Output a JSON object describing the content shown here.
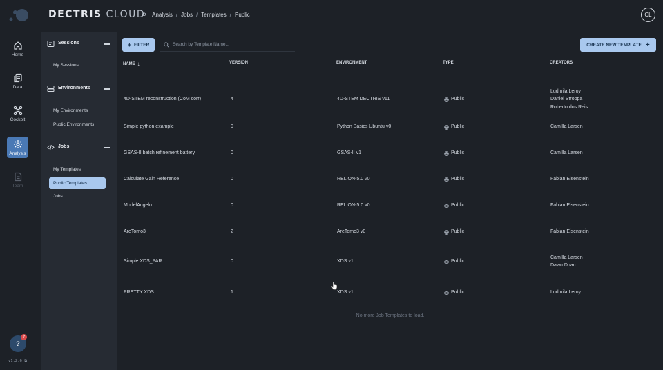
{
  "app": {
    "brand_primary": "DECTRIS",
    "brand_secondary": "CLOUD",
    "avatar_initials": "CL",
    "version": "v1.2.6"
  },
  "breadcrumb": [
    "Analysis",
    "Jobs",
    "Templates",
    "Public"
  ],
  "rail": [
    {
      "label": "Home",
      "icon": "home-icon"
    },
    {
      "label": "Data",
      "icon": "documents-icon"
    },
    {
      "label": "Cockpit",
      "icon": "network-icon"
    },
    {
      "label": "Analysis",
      "icon": "gear-icon",
      "active": true
    },
    {
      "label": "Team",
      "icon": "document-icon",
      "disabled": true
    }
  ],
  "help": {
    "label": "?",
    "badge": "7"
  },
  "sidenav": {
    "sessions": {
      "title": "Sessions",
      "items": [
        "My Sessions"
      ]
    },
    "environments": {
      "title": "Environments",
      "items": [
        "My Environments",
        "Public Environments"
      ]
    },
    "jobs": {
      "title": "Jobs",
      "items": [
        "My Templates",
        "Public Templates",
        "Jobs"
      ],
      "active_index": 1
    }
  },
  "toolbar": {
    "filter_label": "FILTER",
    "search_placeholder": "Search by Template Name...",
    "create_label": "CREATE NEW TEMPLATE"
  },
  "table": {
    "columns": [
      "NAME",
      "VERSION",
      "ENVIRONMENT",
      "TYPE",
      "CREATORS"
    ],
    "rows": [
      {
        "name": "4D-STEM reconstruction (CoM corr)",
        "version": "4",
        "environment": "4D-STEM DECTRIS v11",
        "type": "Public",
        "creators": [
          "Ludmila Leroy",
          "Daniel Stroppa",
          "Roberto dos Reis"
        ]
      },
      {
        "name": "Simple python example",
        "version": "0",
        "environment": "Python Basics Ubuntu v0",
        "type": "Public",
        "creators": [
          "Camilla Larsen"
        ]
      },
      {
        "name": "GSAS-II batch refinement battery",
        "version": "0",
        "environment": "GSAS-II v1",
        "type": "Public",
        "creators": [
          "Camilla Larsen"
        ]
      },
      {
        "name": "Calculate Gain Reference",
        "version": "0",
        "environment": "RELION-5.0 v0",
        "type": "Public",
        "creators": [
          "Fabian Eisenstein"
        ]
      },
      {
        "name": "ModelAngelo",
        "version": "0",
        "environment": "RELION-5.0 v0",
        "type": "Public",
        "creators": [
          "Fabian Eisenstein"
        ]
      },
      {
        "name": "AreTomo3",
        "version": "2",
        "environment": "AreTomo3 v0",
        "type": "Public",
        "creators": [
          "Fabian Eisenstein"
        ]
      },
      {
        "name": "Simple XDS_PAR",
        "version": "0",
        "environment": "XDS v1",
        "type": "Public",
        "creators": [
          "Camilla Larsen",
          "Dawn Duan"
        ]
      },
      {
        "name": "PRETTY XDS",
        "version": "1",
        "environment": "XDS v1",
        "type": "Public",
        "creators": [
          "Ludmila Leroy"
        ]
      }
    ],
    "footer": "No more Job Templates to load."
  },
  "colors": {
    "accent": "#a9c8ee",
    "active_rail": "#4a79b5",
    "background": "#1d2127",
    "panel": "#262b33"
  }
}
